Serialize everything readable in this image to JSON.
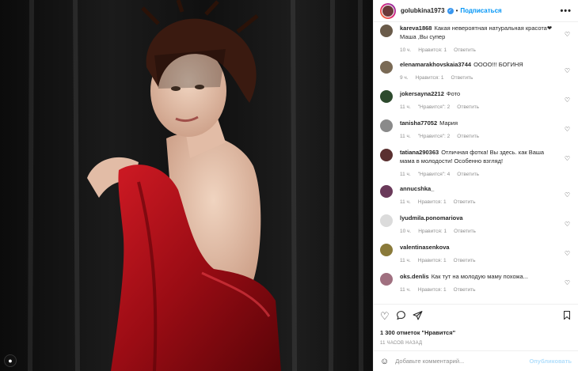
{
  "post": {
    "username": "golubkina1973",
    "follow_label": "Подписаться",
    "more_label": "•••",
    "colors": {
      "accent": "#0095f6",
      "verified": "#3897f0"
    }
  },
  "comments": [
    {
      "user": "kareva1868",
      "text": "Какая невероятная натуральная красота❤ Маша ,Вы супер",
      "time": "10 ч.",
      "likes": "Нравится: 1",
      "reply": "Ответить",
      "avatar_color": "#6a5b4a"
    },
    {
      "user": "elenamarakhovskaia3744",
      "text": "ОООО!!! БОГИНЯ",
      "time": "9 ч.",
      "likes": "Нравится: 1",
      "reply": "Ответить",
      "avatar_color": "#7a6a55"
    },
    {
      "user": "jokersayna2212",
      "text": "Фото",
      "time": "11 ч.",
      "likes": "\"Нравится\": 2",
      "reply": "Ответить",
      "avatar_color": "#2d4a2d"
    },
    {
      "user": "tanisha77052",
      "text": "Мария",
      "time": "11 ч.",
      "likes": "\"Нравится\": 2",
      "reply": "Ответить",
      "avatar_color": "#8a8a8a"
    },
    {
      "user": "tatiana290363",
      "text": "Отличная фотка! Вы здесь. как Ваша мама в молодости! Особенно взгляд!",
      "time": "11 ч.",
      "likes": "\"Нравится\": 4",
      "reply": "Ответить",
      "avatar_color": "#5a3030"
    },
    {
      "user": "annucshka_",
      "text": "",
      "time": "11 ч.",
      "likes": "Нравится: 1",
      "reply": "Ответить",
      "avatar_color": "#6a3a5a"
    },
    {
      "user": "lyudmila.ponomariova",
      "text": "",
      "time": "10 ч.",
      "likes": "Нравится: 1",
      "reply": "Ответить",
      "avatar_color": "#dbdbdb"
    },
    {
      "user": "valentinasenkova",
      "text": "",
      "time": "11 ч.",
      "likes": "Нравится: 1",
      "reply": "Ответить",
      "avatar_color": "#8a7a3a"
    },
    {
      "user": "oks.denlis",
      "text": "Как тут на молодую маму похожа...",
      "time": "11 ч.",
      "likes": "Нравится: 1",
      "reply": "Ответить",
      "avatar_color": "#a07080"
    }
  ],
  "actions": {
    "like_icon": "heart-icon",
    "comment_icon": "comment-icon",
    "share_icon": "share-icon",
    "save_icon": "bookmark-icon"
  },
  "likes_count": "1 300 отметок \"Нравится\"",
  "posted_ago": "11 ЧАСОВ НАЗАД",
  "add_comment": {
    "placeholder": "Добавьте комментарий...",
    "publish_label": "Опубликовать"
  }
}
